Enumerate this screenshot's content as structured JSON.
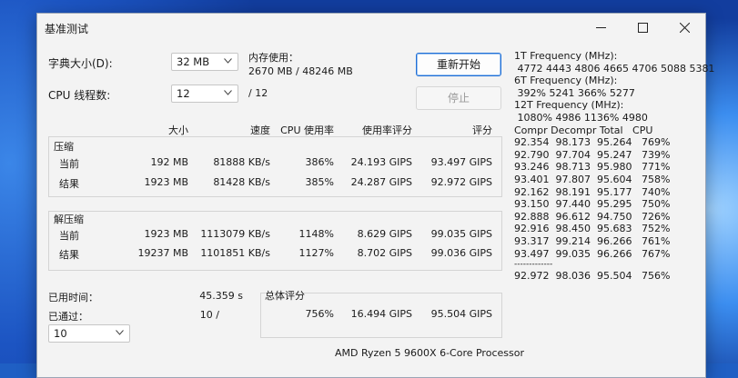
{
  "window": {
    "title": "基准测试"
  },
  "controls": {
    "dict_label": "字典大小(D):",
    "dict_value": "32 MB",
    "mem_label": "内存使用：",
    "mem_value": "2670 MB / 48246 MB",
    "threads_label": "CPU 线程数:",
    "threads_value": "12",
    "threads_total": "/ 12",
    "restart_button": "重新开始",
    "stop_button": "停止"
  },
  "table": {
    "headers": [
      "大小",
      "速度",
      "CPU 使用率",
      "使用率评分",
      "评分"
    ],
    "compress": {
      "title": "压缩",
      "rows": [
        {
          "label": "当前",
          "size": "192 MB",
          "speed": "81888 KB/s",
          "cpu": "386%",
          "usage_rating": "24.193 GIPS",
          "rating": "93.497 GIPS"
        },
        {
          "label": "结果",
          "size": "1923 MB",
          "speed": "81428 KB/s",
          "cpu": "385%",
          "usage_rating": "24.287 GIPS",
          "rating": "92.972 GIPS"
        }
      ]
    },
    "decompress": {
      "title": "解压缩",
      "rows": [
        {
          "label": "当前",
          "size": "1923 MB",
          "speed": "1113079 KB/s",
          "cpu": "1148%",
          "usage_rating": "8.629 GIPS",
          "rating": "99.035 GIPS"
        },
        {
          "label": "结果",
          "size": "19237 MB",
          "speed": "1101851 KB/s",
          "cpu": "1127%",
          "usage_rating": "8.702 GIPS",
          "rating": "99.036 GIPS"
        }
      ]
    }
  },
  "status": {
    "elapsed_label": "已用时间：",
    "elapsed_value": "45.359 s",
    "passes_label": "已通过：",
    "passes_value": "10 /",
    "passes_select": "10"
  },
  "total": {
    "title": "总体评分",
    "cpu": "756%",
    "usage_rating": "16.494 GIPS",
    "rating": "95.504 GIPS"
  },
  "cpu_info": {
    "name": "AMD Ryzen 5 9600X 6-Core Processor"
  },
  "log": [
    "1T Frequency (MHz):",
    " 4772 4443 4806 4665 4706 5088 5381",
    "6T Frequency (MHz):",
    " 392% 5241 366% 5277",
    "12T Frequency (MHz):",
    " 1080% 4986 1136% 4980",
    "Compr Decompr Total   CPU",
    "92.354  98.173  95.264   769%",
    "92.790  97.704  95.247   739%",
    "93.246  98.713  95.980   771%",
    "93.401  97.807  95.604   758%",
    "92.162  98.191  95.177   740%",
    "93.150  97.440  95.295   750%",
    "92.888  96.612  94.750   726%",
    "92.916  98.450  95.683   752%",
    "93.317  99.214  96.266   761%",
    "93.497  99.035  96.266   767%",
    "-------------",
    "92.972  98.036  95.504   756%"
  ]
}
